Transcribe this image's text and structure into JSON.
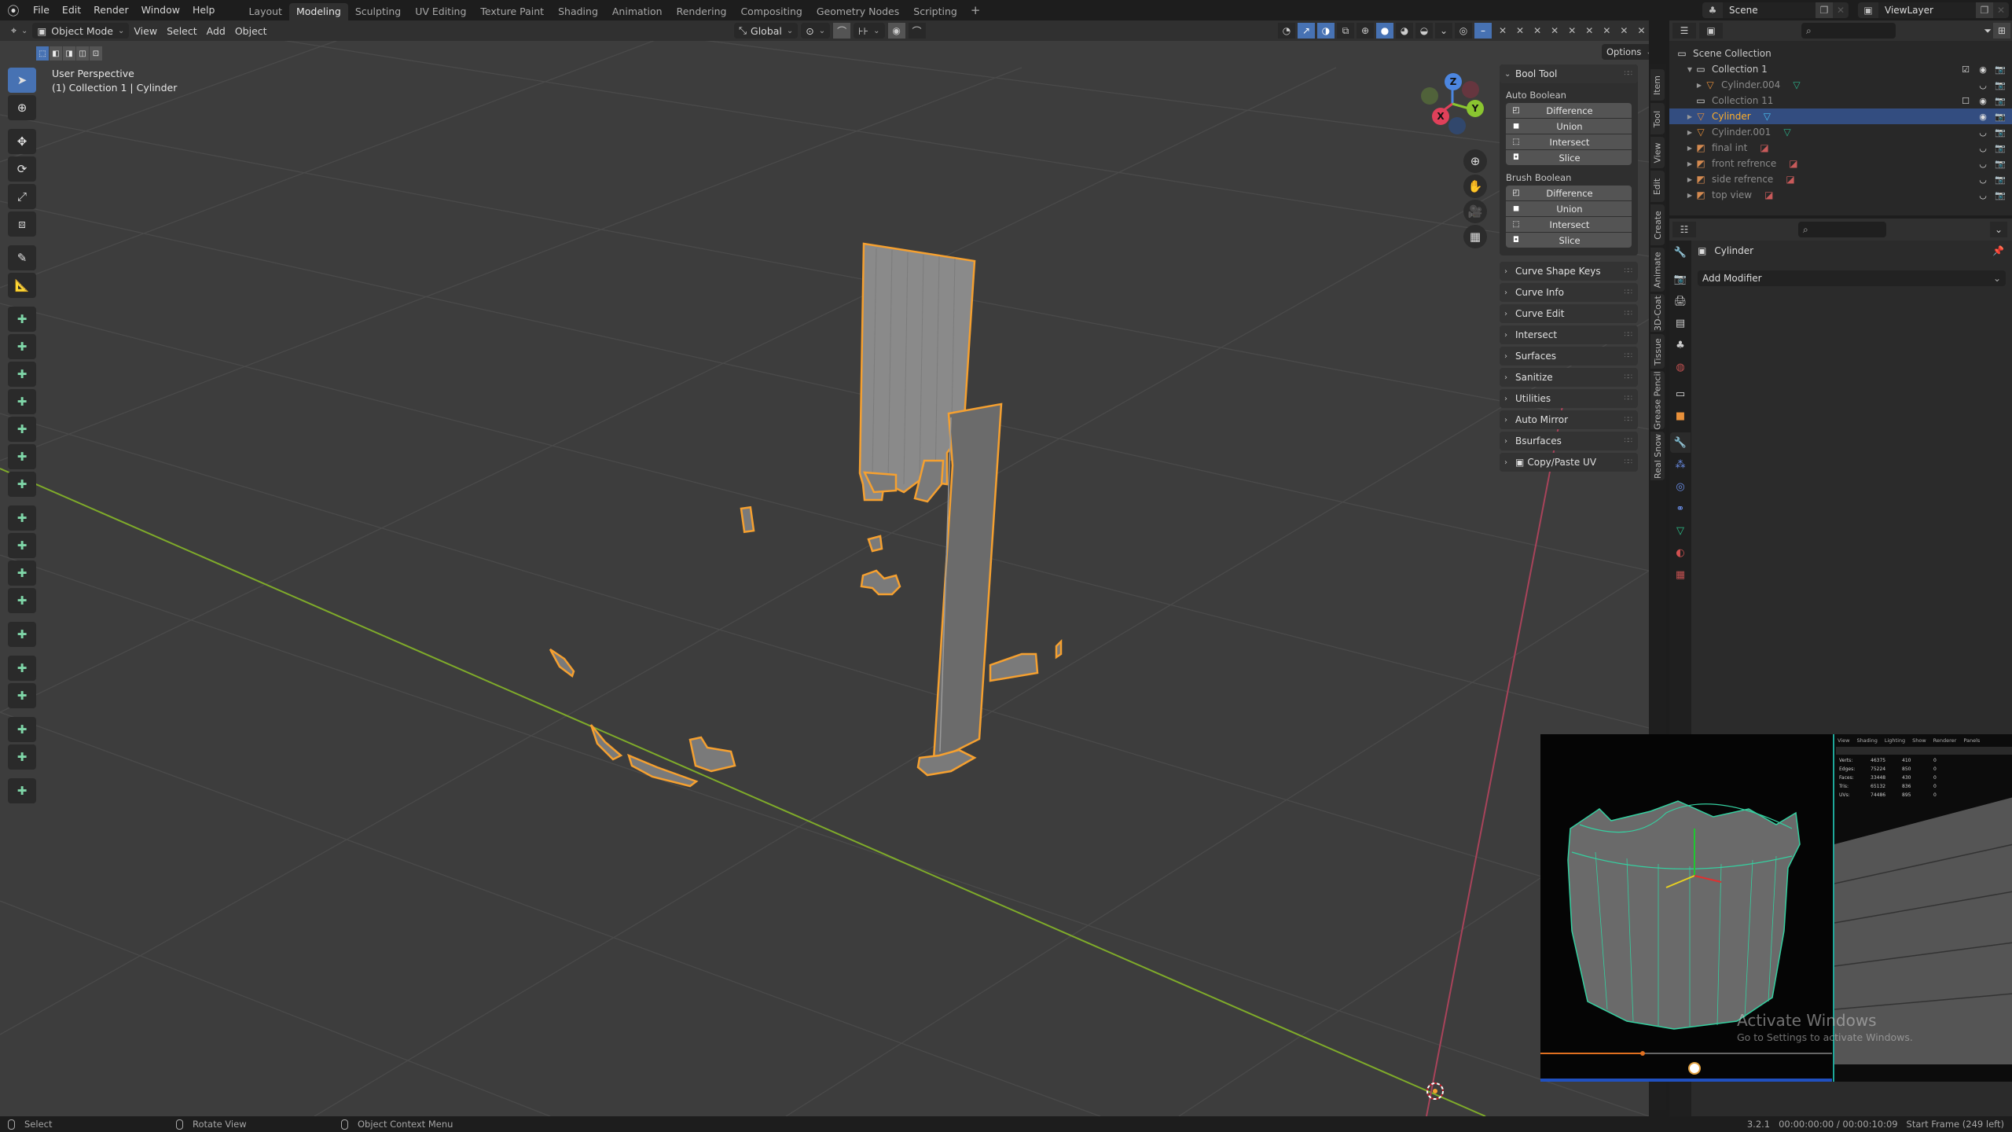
{
  "app": {
    "menus": [
      "File",
      "Edit",
      "Render",
      "Window",
      "Help"
    ],
    "workspaces": [
      {
        "label": "Layout",
        "active": false
      },
      {
        "label": "Modeling",
        "active": true
      },
      {
        "label": "Sculpting",
        "active": false
      },
      {
        "label": "UV Editing",
        "active": false
      },
      {
        "label": "Texture Paint",
        "active": false
      },
      {
        "label": "Shading",
        "active": false
      },
      {
        "label": "Animation",
        "active": false
      },
      {
        "label": "Rendering",
        "active": false
      },
      {
        "label": "Compositing",
        "active": false
      },
      {
        "label": "Geometry Nodes",
        "active": false
      },
      {
        "label": "Scripting",
        "active": false
      }
    ],
    "add_workspace": "+",
    "scene": "Scene",
    "view_layer": "ViewLayer"
  },
  "viewport": {
    "mode": "Object Mode",
    "menus": [
      "View",
      "Select",
      "Add",
      "Object"
    ],
    "transform_orientation": "Global",
    "options_label": "Options",
    "overlay_title": "User Perspective",
    "overlay_subtitle": "(1) Collection 1 | Cylinder",
    "gizmo": {
      "x": "X",
      "y": "Y",
      "z": "Z"
    },
    "colors": {
      "selection_outline": "#f5a030",
      "x_axis": "#c8374a",
      "y_axis": "#7fab2a",
      "background": "#3d3d3d",
      "active_blue": "#4772b3"
    }
  },
  "toolbar": {
    "tools": [
      {
        "name": "select-box",
        "icon": "cursor-arrow-icon",
        "active": true
      },
      {
        "name": "cursor",
        "icon": "3d-cursor-icon"
      },
      {
        "name": "move",
        "icon": "move-icon"
      },
      {
        "name": "rotate",
        "icon": "rotate-icon"
      },
      {
        "name": "scale",
        "icon": "scale-icon"
      },
      {
        "name": "transform",
        "icon": "transform-icon"
      },
      {
        "name": "annotate",
        "icon": "annotate-pencil-icon"
      },
      {
        "name": "measure",
        "icon": "measure-ruler-icon"
      },
      {
        "name": "add-plane",
        "icon": "add-plane-icon"
      },
      {
        "name": "add-cube",
        "icon": "add-cube-icon"
      },
      {
        "name": "add-sphere",
        "icon": "add-sphere-icon"
      },
      {
        "name": "add-cylinder",
        "icon": "add-cylinder-icon"
      },
      {
        "name": "add-cone",
        "icon": "add-cone-icon"
      },
      {
        "name": "add-torus",
        "icon": "add-torus-icon"
      },
      {
        "name": "add-wedge",
        "icon": "add-wedge-icon"
      },
      {
        "name": "add-tree",
        "icon": "add-tree-icon"
      },
      {
        "name": "add-curve",
        "icon": "add-curve-icon"
      },
      {
        "name": "add-scatter",
        "icon": "add-scatter-icon"
      },
      {
        "name": "add-gem",
        "icon": "add-gem-icon"
      },
      {
        "name": "add-arch",
        "icon": "add-arch-icon"
      },
      {
        "name": "add-spring",
        "icon": "add-spring-icon"
      },
      {
        "name": "add-dome",
        "icon": "add-dome-icon"
      },
      {
        "name": "add-box-frame",
        "icon": "add-box-frame-icon"
      },
      {
        "name": "add-box-fill",
        "icon": "add-box-fill-icon"
      },
      {
        "name": "add-cube-outline",
        "icon": "add-cube-outline-icon"
      }
    ]
  },
  "npanel": {
    "bool_tool": {
      "title": "Bool Tool",
      "auto_label": "Auto Boolean",
      "auto_buttons": [
        "Difference",
        "Union",
        "Intersect",
        "Slice"
      ],
      "brush_label": "Brush Boolean",
      "brush_buttons": [
        "Difference",
        "Union",
        "Intersect",
        "Slice"
      ]
    },
    "collapsed_panels": [
      "Curve Shape Keys",
      "Curve Info",
      "Curve Edit",
      "Intersect",
      "Surfaces",
      "Sanitize",
      "Utilities",
      "Auto Mirror",
      "Bsurfaces",
      "Copy/Paste UV"
    ],
    "tabs": [
      "Item",
      "Tool",
      "View",
      "Edit",
      "Create",
      "Animate",
      "3D-Coat",
      "Tissue",
      "Grease Pencil",
      "Real Snow"
    ]
  },
  "outliner": {
    "rows": [
      {
        "name": "Scene Collection",
        "type": "scene-collection",
        "indent": 0
      },
      {
        "name": "Collection 1",
        "type": "collection",
        "indent": 1,
        "expanded": true,
        "checked": true
      },
      {
        "name": "Cylinder.004",
        "type": "mesh",
        "indent": 2,
        "dim": true,
        "hidden": true
      },
      {
        "name": "Collection 11",
        "type": "collection",
        "indent": 1,
        "dim": true,
        "checked": false
      },
      {
        "name": "Cylinder",
        "type": "mesh",
        "indent": 1,
        "selected": true
      },
      {
        "name": "Cylinder.001",
        "type": "mesh",
        "indent": 1,
        "dim": true,
        "hidden": true
      },
      {
        "name": "final int",
        "type": "image",
        "indent": 1,
        "dim": true,
        "hidden": true
      },
      {
        "name": "front refrence",
        "type": "image",
        "indent": 1,
        "dim": true,
        "hidden": true
      },
      {
        "name": "side refrence",
        "type": "image",
        "indent": 1,
        "dim": true,
        "hidden": true
      },
      {
        "name": "top view",
        "type": "image",
        "indent": 1,
        "dim": true,
        "hidden": true
      }
    ]
  },
  "properties": {
    "object_name": "Cylinder",
    "add_modifier": "Add Modifier",
    "tabs": [
      "tool-icon",
      "render-icon",
      "output-icon",
      "view-layer-icon",
      "scene-icon",
      "world-icon",
      "collection-icon",
      "object-icon",
      "modifier-icon",
      "particles-icon",
      "physics-icon",
      "constraints-icon",
      "data-icon",
      "material-icon",
      "texture-icon"
    ],
    "active_tab": "modifier-icon"
  },
  "video_overlay": {
    "menu": [
      "View",
      "Shading",
      "Lighting",
      "Show",
      "Renderer",
      "Panels"
    ],
    "stats": [
      {
        "label": "Verts:",
        "v1": "46375",
        "v2": "410",
        "v3": "0"
      },
      {
        "label": "Edges:",
        "v1": "75224",
        "v2": "850",
        "v3": "0"
      },
      {
        "label": "Faces:",
        "v1": "33448",
        "v2": "430",
        "v3": "0"
      },
      {
        "label": "Tris:",
        "v1": "65132",
        "v2": "836",
        "v3": "0"
      },
      {
        "label": "UVs:",
        "v1": "74486",
        "v2": "895",
        "v3": "0"
      }
    ],
    "progress": 0.35,
    "watermark_title": "Activate Windows",
    "watermark_sub": "Go to Settings to activate Windows."
  },
  "statusbar": {
    "select": "Select",
    "rotate": "Rotate View",
    "context": "Object Context Menu",
    "info": "3.2.1   00:00:00:00 / 00:00:10:09   Start Frame (249 left)"
  }
}
